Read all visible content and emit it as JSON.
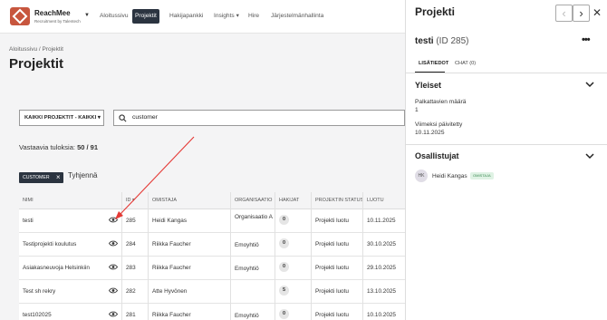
{
  "app": {
    "brand": "ReachMee",
    "brand_sub": "Recruitment by Talentech"
  },
  "nav": {
    "items": [
      "Aloitussivu",
      "Projektit",
      "Hakijapankki",
      "Insights",
      "Hire",
      "Järjestelmänhallinta"
    ]
  },
  "page": {
    "breadcrumb": "Aloitussivu  /  Projektit",
    "title": "Projektit",
    "filter_label": "KAIKKI PROJEKTIT - KAIKKI",
    "search_value": "customer",
    "results_prefix": "Vastaavia tuloksia: ",
    "results_count": "50 / 91",
    "chip_label": "CUSTOMER",
    "clear_label": "Tyhjennä"
  },
  "table": {
    "headers": {
      "name": "NIMI",
      "id": "ID",
      "owner": "OMISTAJA",
      "org": "ORGANISAATIO",
      "applicants": "HAKIJAT",
      "status": "PROJEKTIN STATUS",
      "created": "LUOTU"
    },
    "rows": [
      {
        "name": "testi",
        "id": "285",
        "owner": "Heidi Kangas",
        "org": "Organisaatio A",
        "applicants": "0",
        "status": "Projekti luotu",
        "created": "10.11.2025"
      },
      {
        "name": "Testiprojekti koulutus",
        "id": "284",
        "owner": "Riikka Faucher",
        "org": "Emoyhtiö",
        "applicants": "0",
        "status": "Projekti luotu",
        "created": "30.10.2025"
      },
      {
        "name": "Asiakasneuvoja Helsinkiin",
        "id": "283",
        "owner": "Riikka Faucher",
        "org": "Emoyhtiö",
        "applicants": "0",
        "status": "Projekti luotu",
        "created": "29.10.2025"
      },
      {
        "name": "Test sh rekry",
        "id": "282",
        "owner": "Atte Hyvönen",
        "org": "",
        "applicants": "5",
        "status": "Projekti luotu",
        "created": "13.10.2025"
      },
      {
        "name": "test102025",
        "id": "281",
        "owner": "Riikka Faucher",
        "org": "Emoyhtiö",
        "applicants": "0",
        "status": "Projekti luotu",
        "created": "10.10.2025"
      }
    ]
  },
  "panel": {
    "title": "Projekti",
    "project_name": "testi",
    "project_id": "(ID 285)",
    "tabs": [
      "LISÄTIEDOT",
      "CHAT (0)"
    ],
    "general_title": "Yleiset",
    "hires_label": "Palkattavien määrä",
    "hires_value": "1",
    "updated_label": "Viimeksi päivitetty",
    "updated_value": "10.11.2025",
    "participants_title": "Osallistujat",
    "participant_initials": "HK",
    "participant_name": "Heidi Kangas",
    "participant_role": "OMISTAJA"
  },
  "colors": {
    "accent": "#2b3440",
    "annotation_arrow": "#e53935",
    "brand": "#c7563e"
  }
}
